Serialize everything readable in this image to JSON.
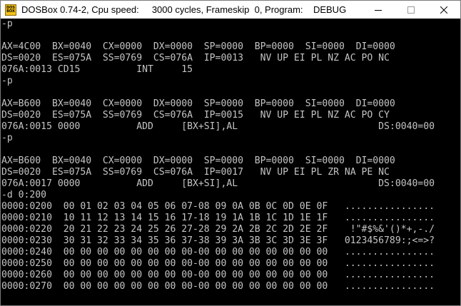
{
  "window": {
    "icon_text_top": "DOS",
    "icon_text_bottom": "BOX",
    "title": "DOSBox 0.74-2, Cpu speed:     3000 cycles, Frameskip  0, Program:    DEBUG",
    "colors": {
      "title_background": "#ffffff",
      "console_background": "#000000",
      "console_text": "#c4c4c4"
    }
  },
  "caption_buttons": {
    "minimize": "minimize-icon",
    "maximize": "maximize-icon",
    "close": "close-icon"
  },
  "console": {
    "lines": [
      "-p",
      "",
      "AX=4C00  BX=0040  CX=0000  DX=0000  SP=0000  BP=0000  SI=0000  DI=0000",
      "DS=0020  ES=075A  SS=0769  CS=076A  IP=0013   NV UP EI PL NZ AC PO NC",
      "076A:0013 CD15          INT     15",
      "-p",
      "",
      "AX=B600  BX=0040  CX=0000  DX=0000  SP=0000  BP=0000  SI=0000  DI=0000",
      "DS=0020  ES=075A  SS=0769  CS=076A  IP=0015   NV UP EI PL NZ AC PO CY",
      "076A:0015 0000          ADD     [BX+SI],AL                         DS:0040=00",
      "-p",
      "",
      "AX=B600  BX=0040  CX=0000  DX=0000  SP=0000  BP=0000  SI=0000  DI=0000",
      "DS=0020  ES=075A  SS=0769  CS=076A  IP=0017   NV UP EI PL ZR NA PE NC",
      "076A:0017 0000          ADD     [BX+SI],AL                         DS:0040=00",
      "-d 0:200",
      "0000:0200  00 01 02 03 04 05 06 07-08 09 0A 0B 0C 0D 0E 0F   ................",
      "0000:0210  10 11 12 13 14 15 16 17-18 19 1A 1B 1C 1D 1E 1F   ................",
      "0000:0220  20 21 22 23 24 25 26 27-28 29 2A 2B 2C 2D 2E 2F    !\"#$%&'()*+,-./",
      "0000:0230  30 31 32 33 34 35 36 37-38 39 3A 3B 3C 3D 3E 3F   0123456789:;<=>?",
      "0000:0240  00 00 00 00 00 00 00 00-00 00 00 00 00 00 00 00   ................",
      "0000:0250  00 00 00 00 00 00 00 00-00 00 00 00 00 00 00 00   ................",
      "0000:0260  00 00 00 00 00 00 00 00-00 00 00 00 00 00 00 00   ................",
      "0000:0270  00 00 00 00 00 00 00 00-00 00 00 00 00 00 00 00   ................"
    ]
  }
}
